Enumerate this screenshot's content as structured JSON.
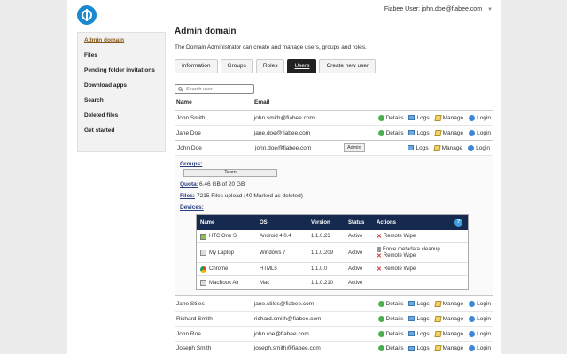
{
  "header": {
    "user_label": "Fiabee User: john.doe@fiabee.com",
    "menu_caret": "▼"
  },
  "sidebar": {
    "items": [
      {
        "label": "Admin domain",
        "active": true
      },
      {
        "label": "Files"
      },
      {
        "label": "Pending folder invitations"
      },
      {
        "label": "Download apps"
      },
      {
        "label": "Search"
      },
      {
        "label": "Deleted files"
      },
      {
        "label": "Get started"
      }
    ]
  },
  "main": {
    "title": "Admin domain",
    "description": "The Domain Administrator can create and manage users, groups and roles.",
    "tabs": [
      {
        "label": "Information"
      },
      {
        "label": "Groups"
      },
      {
        "label": "Roles"
      },
      {
        "label": "Users",
        "active": true
      },
      {
        "label": "Create new user"
      }
    ],
    "search": {
      "placeholder": "Search user"
    },
    "columns": {
      "name": "Name",
      "email": "Email"
    },
    "actions": {
      "details": "Details",
      "logs": "Logs",
      "manage": "Manage",
      "login": "Login"
    },
    "users_top": [
      {
        "name": "John Smith",
        "email": "john.smith@fiabee.com"
      },
      {
        "name": "Jane Doe",
        "email": "jane.doe@fiabee.com"
      }
    ],
    "expanded_user": {
      "name": "John Doe",
      "email": "john.doe@fiabee.com",
      "badge": "Admin",
      "groups_label": "Groups:",
      "group": "Team",
      "quota_label": "Quota:",
      "quota_value": "6.46 GB of 20 GB",
      "files_label": "Files:",
      "files_value": "7215 Files upload (40 Marked as deleted)",
      "devices_label": "Devices:",
      "devices_header": {
        "name": "Name",
        "os": "OS",
        "version": "Version",
        "status": "Status",
        "actions": "Actions",
        "help": "?"
      },
      "devices": [
        {
          "icon": "phone-icon",
          "name": "HTC One S",
          "os": "Android 4.0.4",
          "version": "1.1.0.23",
          "status": "Active",
          "actions": [
            "Remote Wipe"
          ]
        },
        {
          "icon": "laptop-icon",
          "name": "My Laptop",
          "os": "Windows 7",
          "version": "1.1.0.209",
          "status": "Active",
          "actions": [
            "Force metadata cleanup",
            "Remote Wipe"
          ]
        },
        {
          "icon": "chrome-icon",
          "name": "Chrome",
          "os": "HTML5",
          "version": "1.1.0.0",
          "status": "Active",
          "actions": [
            "Remote Wipe"
          ]
        },
        {
          "icon": "macbook-icon",
          "name": "MacBook Air",
          "os": "Mac",
          "version": "1.1.0.210",
          "status": "Active",
          "actions": []
        }
      ]
    },
    "users_bottom": [
      {
        "name": "Jane Stiles",
        "email": "jane.stiles@fiabee.com"
      },
      {
        "name": "Richard Smith",
        "email": "richard.smith@fiabee.com"
      },
      {
        "name": "John Roe",
        "email": "john.roe@fiabee.com"
      },
      {
        "name": "Joseph Smith",
        "email": "joseph.smith@fiabee.com"
      }
    ]
  }
}
